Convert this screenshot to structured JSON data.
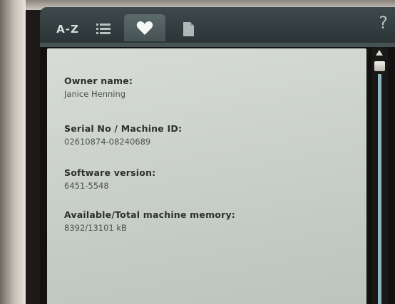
{
  "tabs": {
    "az_label": "A-Z",
    "list_icon": "list-icon",
    "favorites_icon": "heart-icon",
    "document_icon": "document-icon",
    "help_label": "?"
  },
  "info": {
    "owner_label": "Owner name:",
    "owner_value": "Janice Henning",
    "serial_label": "Serial No / Machine ID:",
    "serial_value": "02610874-08240689",
    "software_label": "Software version:",
    "software_value": "6451-5548",
    "memory_label": "Available/Total machine memory:",
    "memory_value": "8392/13101 kB"
  },
  "colors": {
    "tabbar": "#3f4a4c",
    "active_tab": "#5c6a6b",
    "content_background": "#d7dcd6",
    "scroll_rail": "#8fb7c3"
  }
}
